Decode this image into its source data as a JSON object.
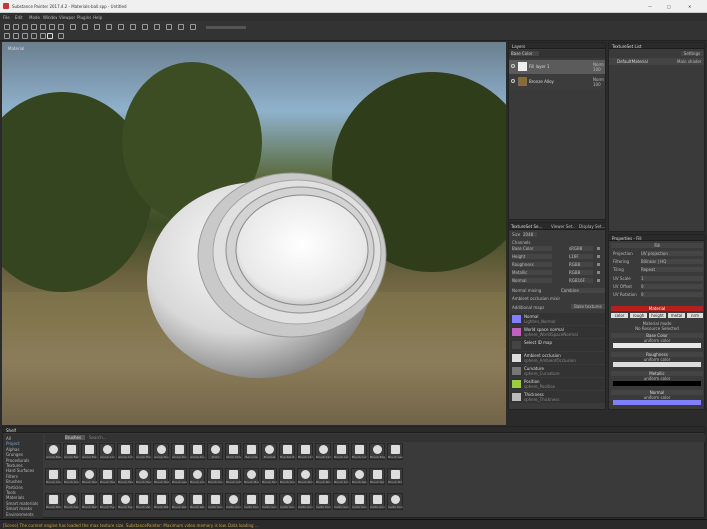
{
  "window": {
    "title": "Substance Painter 2017.4.2 - Materials-ball.spp - Untitled",
    "min": "—",
    "max": "□",
    "close": "✕"
  },
  "menu": [
    "File",
    "Edit",
    "Mode",
    "Window",
    "Viewport",
    "Plugins",
    "Help"
  ],
  "viewport": {
    "label": "Material"
  },
  "layers": {
    "title": "Layers",
    "blend": "Base Color",
    "items": [
      {
        "name": "Fill layer 1",
        "mode": "Norm",
        "opacity": "100"
      },
      {
        "name": "Bronze Alloy",
        "mode": "Norm",
        "opacity": "100"
      }
    ]
  },
  "textureset_list": {
    "title": "TextureSet List",
    "settings": "Settings",
    "item": "DefaultMaterial",
    "shader": "Main shader"
  },
  "textureset_settings": {
    "tabs": [
      "TextureSet Se...",
      "Viewer Set...",
      "Display Set..."
    ],
    "size_label": "Size",
    "size": "2048",
    "channels_label": "Channels",
    "channels": [
      {
        "name": "Base Color",
        "fmt": "sRGB8"
      },
      {
        "name": "Height",
        "fmt": "L16F"
      },
      {
        "name": "Roughness",
        "fmt": "RGB8"
      },
      {
        "name": "Metallic",
        "fmt": "RGB8"
      },
      {
        "name": "Normal",
        "fmt": "RGB16F"
      }
    ],
    "normal_mix": "Normal mixing",
    "normal_mix_val": "Combine",
    "ao_label": "Ambient occlusion mixing",
    "additional_maps": "Additional maps",
    "bake": "Bake textures",
    "maps": [
      {
        "name": "Normal",
        "sub": "Lighten_Normal"
      },
      {
        "name": "World space normal",
        "sub": "sphere_WorldSpaceNormal"
      },
      {
        "name": "Select ID map",
        "sub": ""
      },
      {
        "name": "Ambient occlusion",
        "sub": "sphere_AmbientOcclusion"
      },
      {
        "name": "Curvature",
        "sub": "sphere_Curvature"
      },
      {
        "name": "Position",
        "sub": "sphere_Position"
      },
      {
        "name": "Thickness",
        "sub": "sphere_Thickness"
      }
    ]
  },
  "properties": {
    "title": "Properties - Fill",
    "section_fill": "Fill",
    "projection_label": "Projection",
    "projection": "UV projection",
    "filtering_label": "Filtering",
    "filtering": "Bilinear | HQ",
    "tiling_label": "Tiling",
    "tiling": "Repeat",
    "uv_scale": "UV Scale",
    "uv_offset": "UV Offset",
    "uv_rotation": "UV Rotation",
    "uv_scale_val": "1",
    "uv_offset_val": "0",
    "uv_rotation_val": "0",
    "material_head": "Material",
    "modes": [
      "color",
      "rough",
      "height",
      "metal",
      "nrm"
    ],
    "material_mode": "Material mode",
    "no_resource": "No Resource Selected",
    "channels": [
      {
        "name": "Base Color",
        "uniform": "uniform color",
        "color": "#e8e8e8"
      },
      {
        "name": "Roughness",
        "uniform": "uniform color",
        "color": "#dcdcdc"
      },
      {
        "name": "Metallic",
        "uniform": "uniform color",
        "color": "#000000"
      },
      {
        "name": "Normal",
        "uniform": "uniform color",
        "color": "#8080ff"
      }
    ]
  },
  "shelf": {
    "title": "Shelf",
    "filter": "Brushes",
    "search": "Search...",
    "categories": [
      "All",
      "Project",
      "Alphas",
      "Grunges",
      "Procedurals",
      "Textures",
      "Hard Surfaces",
      "Filters",
      "Brushes",
      "Particles",
      "Tools",
      "Materials",
      "Smart materials",
      "Smart masks",
      "Environments"
    ],
    "row1": [
      "Arrow Basic",
      "Arrow Ben...",
      "Arrow Bold",
      "Arrow Circle",
      "Arrow Circle",
      "Arrow Tria...",
      "Arrow Doub...",
      "Arrow Doub...",
      "Arrow Doub...",
      "Atom",
      "Atom Simple",
      "Barcode",
      "Bracket",
      "Bracket Rev...",
      "Brush Circle",
      "Brush Circu...",
      "Brush Corner",
      "Brush Curve",
      "Brush Edge",
      "Brush Leng..."
    ],
    "row2": [
      "Brush Grass",
      "Brush Grass",
      "Brush Hair",
      "Brush Hair",
      "Brush Hair",
      "Brush Hair",
      "Brush Hair",
      "Brush Leaf",
      "Brush Line",
      "Brush Line",
      "Brush Loft",
      "Brush Moss",
      "Brush Noise",
      "Brush Ova...",
      "Brush Point",
      "Brush Rocks",
      "Brush Scra...",
      "Brush Spla...",
      "Brush Spra...",
      "Brush Str..."
    ],
    "row3": [
      "Brush Stone",
      "Brush Swirl",
      "Brush Textu...",
      "Brush Tige",
      "Brush Tige",
      "Brush Velvet",
      "Brush Waves",
      "Brush Wood",
      "Brush Wood",
      "Celtic Knot",
      "Celtic Knot",
      "Celtic Knot",
      "Celtic Knot",
      "Celtic Knot",
      "Celtic Knot",
      "Celtic Knot",
      "Celtic Knot",
      "Celtic Knot",
      "Celtic Knot",
      "Celtic Knot"
    ]
  },
  "status": "[Scene] The current engine has loaded the max texture size. SubstancePainter: Maximum video memory is low. Data loading ..."
}
